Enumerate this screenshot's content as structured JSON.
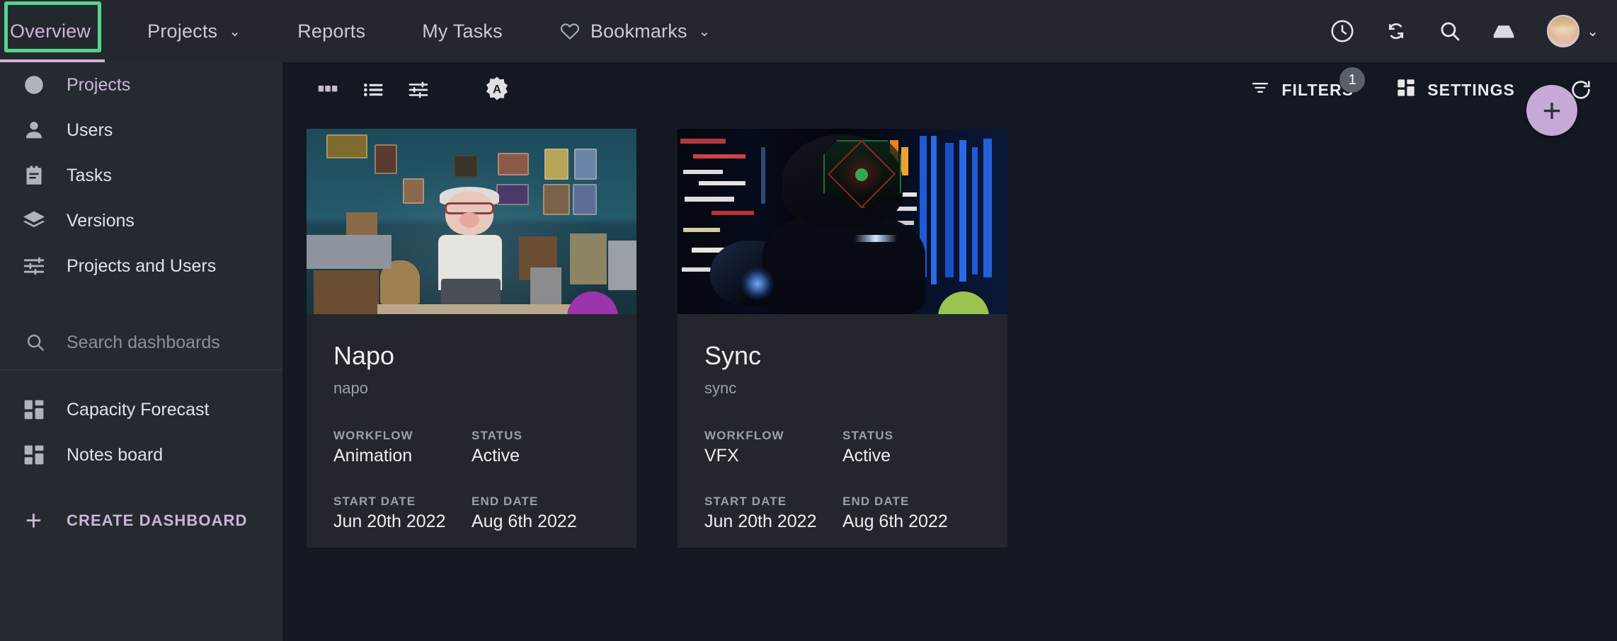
{
  "topnav": {
    "tabs": [
      {
        "label": "Overview",
        "active": true,
        "caret": false,
        "icon": null
      },
      {
        "label": "Projects",
        "active": false,
        "caret": true,
        "icon": null
      },
      {
        "label": "Reports",
        "active": false,
        "caret": false,
        "icon": null
      },
      {
        "label": "My Tasks",
        "active": false,
        "caret": false,
        "icon": null
      },
      {
        "label": "Bookmarks",
        "active": false,
        "caret": true,
        "icon": "heart-icon"
      }
    ],
    "caret_glyph": "⌄",
    "icons": [
      "history-clock-icon",
      "sync-icon",
      "search-icon",
      "inbox-icon"
    ],
    "avatar_caret": "⌄",
    "highlight_color": "#54d48c",
    "active_color": "#cdb4d8"
  },
  "sidebar": {
    "items": [
      {
        "label": "Projects",
        "icon": "circle-icon",
        "accent": true
      },
      {
        "label": "Users",
        "icon": "person-icon",
        "accent": false
      },
      {
        "label": "Tasks",
        "icon": "clipboard-icon",
        "accent": false
      },
      {
        "label": "Versions",
        "icon": "layers-icon",
        "accent": false
      },
      {
        "label": "Projects and Users",
        "icon": "tune-icon",
        "accent": false
      }
    ],
    "search": {
      "placeholder": "Search dashboards",
      "value": ""
    },
    "dashboards": [
      {
        "label": "Capacity Forecast",
        "icon": "dashboard-icon"
      },
      {
        "label": "Notes board",
        "icon": "dashboard-icon"
      }
    ],
    "create": {
      "label": "CREATE DASHBOARD",
      "plus": "+"
    }
  },
  "toolbar": {
    "view_buttons": [
      {
        "name": "grid-view",
        "active": true
      },
      {
        "name": "list-view",
        "active": false
      },
      {
        "name": "tune-view",
        "active": false
      }
    ],
    "assignee_badge": "A",
    "filters": {
      "label": "FILTERS",
      "badge": "1"
    },
    "settings": {
      "label": "SETTINGS"
    },
    "refresh": {
      "name": "refresh-icon"
    },
    "fab": {
      "glyph": "+",
      "color": "#c6a9d6"
    }
  },
  "cards": [
    {
      "title": "Napo",
      "subtitle": "napo",
      "badge_color": "#9c35ab",
      "thumbnail": "animated-character-in-room",
      "fields": [
        {
          "label": "WORKFLOW",
          "value": "Animation"
        },
        {
          "label": "STATUS",
          "value": "Active"
        },
        {
          "label": "START DATE",
          "value": "Jun 20th 2022"
        },
        {
          "label": "END DATE",
          "value": "Aug 6th 2022"
        }
      ]
    },
    {
      "title": "Sync",
      "subtitle": "sync",
      "badge_color": "#9ac34f",
      "thumbnail": "cyberpunk-mech-neon-city",
      "fields": [
        {
          "label": "WORKFLOW",
          "value": "VFX"
        },
        {
          "label": "STATUS",
          "value": "Active"
        },
        {
          "label": "START DATE",
          "value": "Jun 20th 2022"
        },
        {
          "label": "END DATE",
          "value": "Aug 6th 2022"
        }
      ]
    }
  ]
}
